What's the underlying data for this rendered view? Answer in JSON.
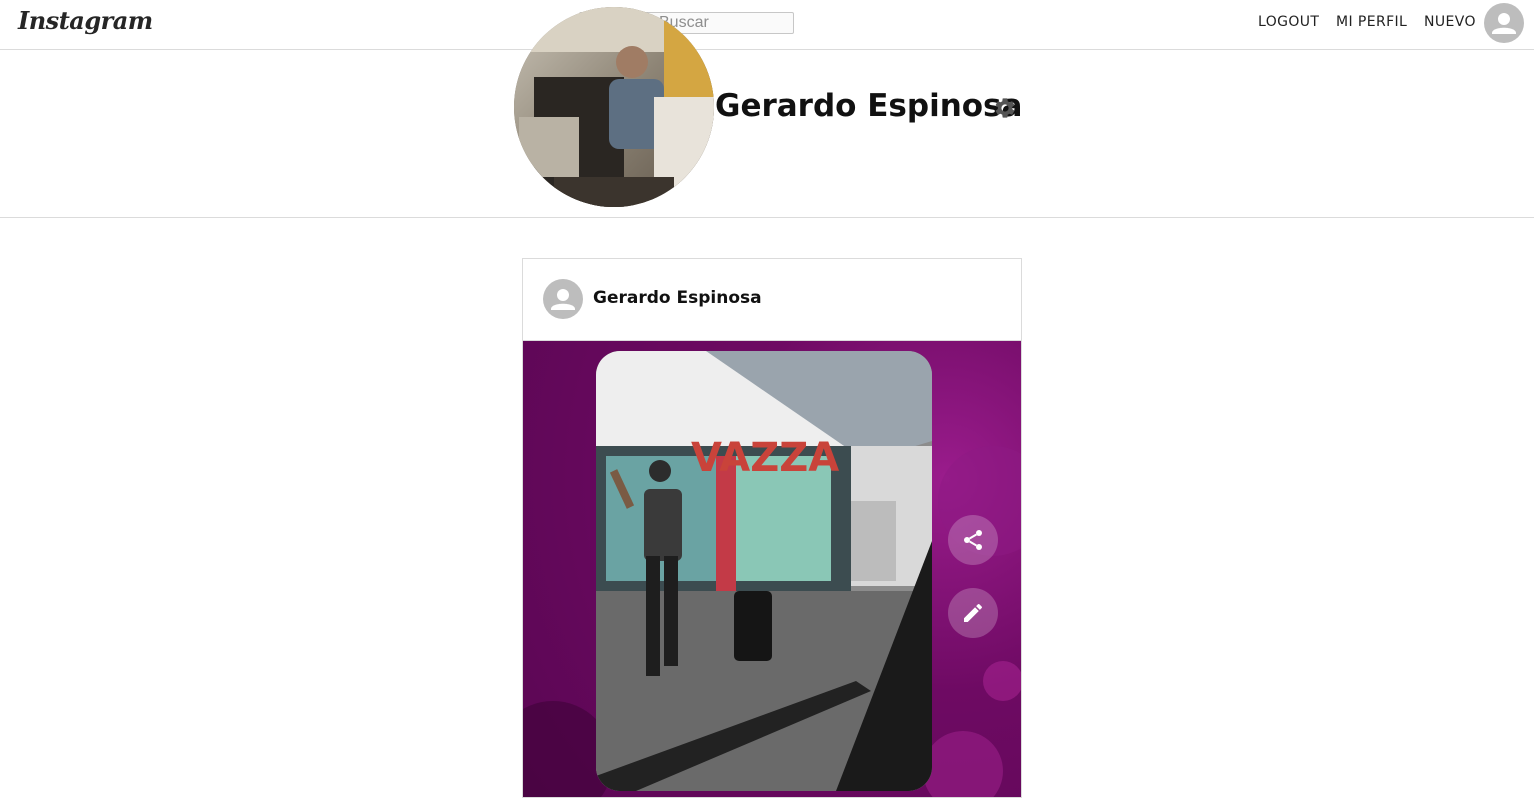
{
  "topbar": {
    "logo": "Instagram",
    "search_placeholder": "Buscar",
    "nav": {
      "logout": "LOGOUT",
      "profile": "MI PERFIL",
      "new": "NUEVO"
    }
  },
  "profile": {
    "name": "Gerardo Espinosa"
  },
  "post": {
    "author": "Gerardo Espinosa"
  },
  "colors": {
    "media_background": "#6e0a63",
    "border": "#dbdbdb",
    "avatar_placeholder": "#bdbdbd"
  }
}
